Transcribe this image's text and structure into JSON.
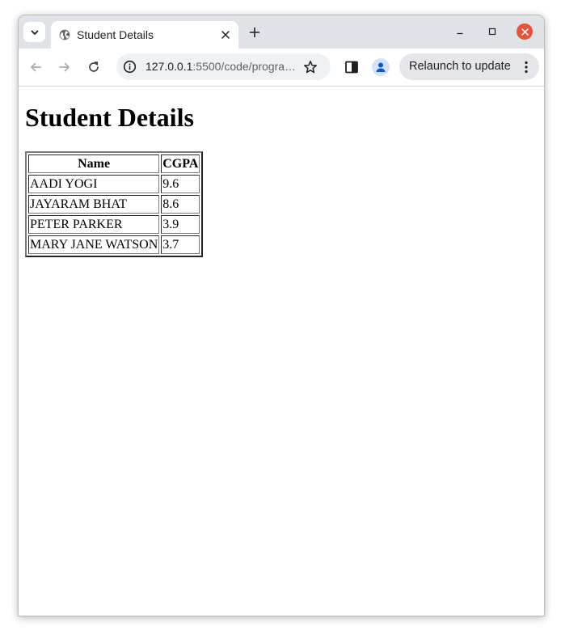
{
  "browser": {
    "tab": {
      "title": "Student Details"
    },
    "address_bar": {
      "host": "127.0.0.1",
      "path": ":5500/code/progra…"
    },
    "relaunch_label": "Relaunch to update",
    "icons": {
      "tab_search": "chevron-down-icon",
      "favicon": "globe-icon",
      "tab_close": "close-icon",
      "new_tab": "plus-icon",
      "minimize": "minimize-icon",
      "maximize": "maximize-icon",
      "close": "close-icon",
      "back": "arrow-left-icon",
      "forward": "arrow-right-icon",
      "reload": "reload-icon",
      "site_info": "info-icon",
      "bookmark": "star-icon",
      "side_panel": "side-panel-icon",
      "profile": "person-icon",
      "menu": "three-dots-vertical-icon"
    },
    "colors": {
      "tabstrip": "#dfe3e7",
      "close_button": "#e5533a",
      "relaunch_button": "#e4e6e9",
      "omnibox": "#eff2f5"
    }
  },
  "page": {
    "heading": "Student Details",
    "table": {
      "headers": [
        "Name",
        "CGPA"
      ],
      "rows": [
        [
          "AADI YOGI",
          "9.6"
        ],
        [
          "JAYARAM BHAT",
          "8.6"
        ],
        [
          "PETER PARKER",
          "3.9"
        ],
        [
          "MARY JANE WATSON",
          "3.7"
        ]
      ]
    }
  }
}
